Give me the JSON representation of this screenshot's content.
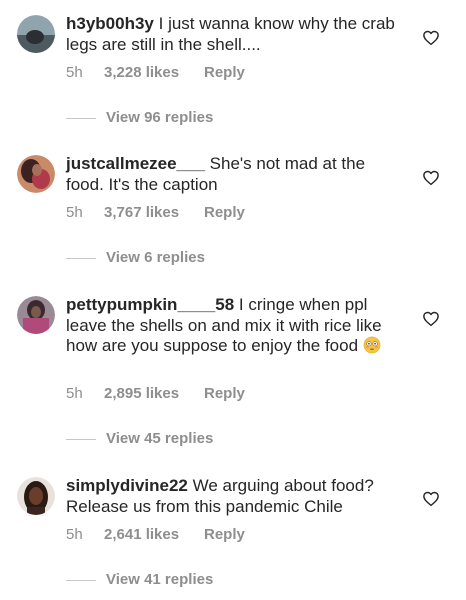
{
  "comments": [
    {
      "username": "h3yb00h3y",
      "text": "I just wanna know why the crab legs are still in the shell....",
      "time": "5h",
      "likes": "3,228 likes",
      "reply": "Reply",
      "view_replies": "View 96 replies",
      "avatar_color": "#5a6a72"
    },
    {
      "username": "justcallmezee___",
      "text": "She's not mad at the food. It's the caption",
      "time": "5h",
      "likes": "3,767 likes",
      "reply": "Reply",
      "view_replies": "View 6 replies",
      "avatar_color": "#7a3a3a"
    },
    {
      "username": "pettypumpkin____58",
      "text": "I cringe when ppl leave the shells on and mix it with rice like how are you suppose to enjoy the food",
      "time": "5h",
      "likes": "2,895 likes",
      "reply": "Reply",
      "view_replies": "View 45 replies",
      "avatar_color": "#6a5560"
    },
    {
      "username": "simplydivine22",
      "text": "We arguing about food? Release us from this pandemic Chile",
      "time": "5h",
      "likes": "2,641 likes",
      "reply": "Reply",
      "view_replies": "View 41 replies",
      "avatar_color": "#3a2a25"
    }
  ],
  "icons": {
    "like": "heart-outline-icon",
    "emoji": "flushed-face-emoji"
  },
  "colors": {
    "text": "#262626",
    "muted": "#8e8e8e",
    "background": "#ffffff"
  }
}
